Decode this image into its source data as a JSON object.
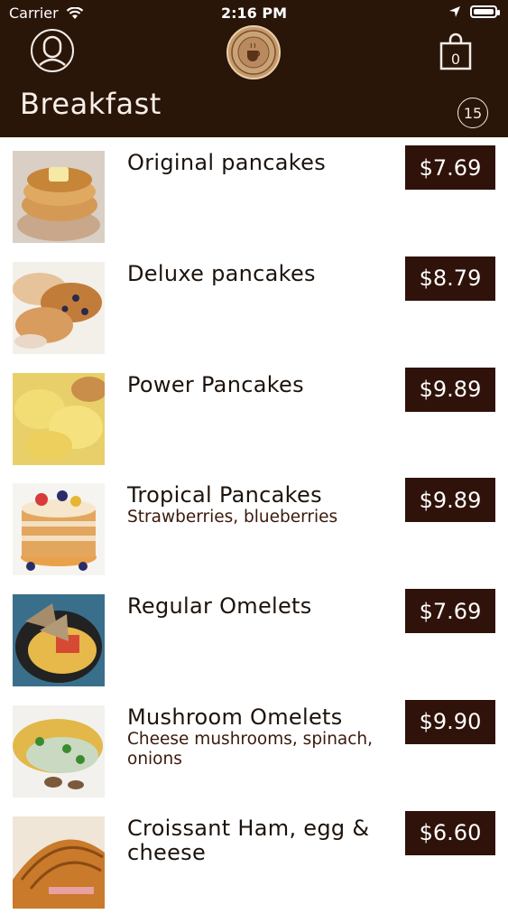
{
  "status_bar": {
    "carrier": "Carrier",
    "time": "2:16 PM"
  },
  "section": {
    "title": "Breakfast",
    "count": "15"
  },
  "theme": {
    "header_bg": "#2a1509",
    "price_bg": "#2f1209"
  },
  "items": [
    {
      "name": "Original pancakes",
      "desc": "",
      "price": "$7.69"
    },
    {
      "name": "Deluxe pancakes",
      "desc": "",
      "price": "$8.79"
    },
    {
      "name": "Power Pancakes",
      "desc": "",
      "price": "$9.89"
    },
    {
      "name": "Tropical Pancakes",
      "desc": "Strawberries, blueberries",
      "price": "$9.89"
    },
    {
      "name": "Regular Omelets",
      "desc": "",
      "price": "$7.69"
    },
    {
      "name": "Mushroom Omelets",
      "desc": "Cheese mushrooms, spinach, onions",
      "price": "$9.90"
    },
    {
      "name": "Croissant Ham, egg & cheese",
      "desc": "",
      "price": "$6.60"
    }
  ]
}
